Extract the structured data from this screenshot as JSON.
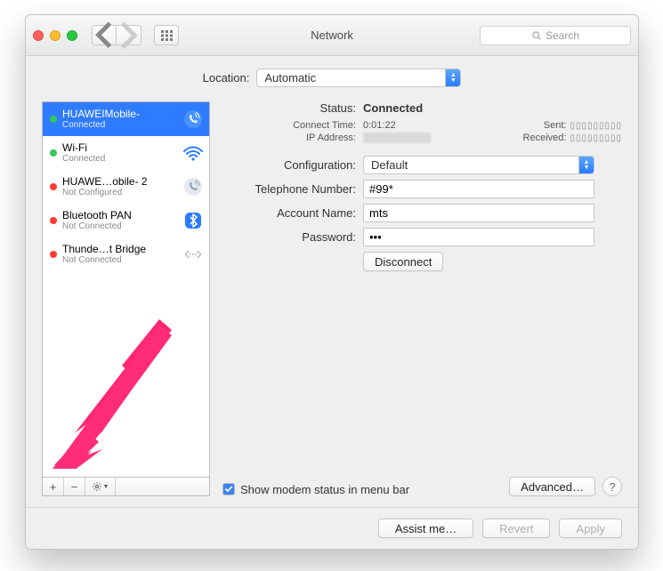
{
  "window": {
    "title": "Network"
  },
  "toolbar": {
    "search_placeholder": "Search"
  },
  "location": {
    "label": "Location:",
    "value": "Automatic"
  },
  "sidebar": {
    "items": [
      {
        "name": "HUAWEIMobile-",
        "status": "Connected",
        "status_color": "green",
        "icon": "phone",
        "selected": true
      },
      {
        "name": "Wi-Fi",
        "status": "Connected",
        "status_color": "green",
        "icon": "wifi",
        "selected": false
      },
      {
        "name": "HUAWE…obile- 2",
        "status": "Not Configured",
        "status_color": "red",
        "icon": "phone-gray",
        "selected": false
      },
      {
        "name": "Bluetooth PAN",
        "status": "Not Connected",
        "status_color": "red",
        "icon": "bluetooth",
        "selected": false
      },
      {
        "name": "Thunde…t Bridge",
        "status": "Not Connected",
        "status_color": "red",
        "icon": "thunderbolt",
        "selected": false
      }
    ],
    "add": "+",
    "remove": "−"
  },
  "detail": {
    "status_label": "Status:",
    "status_value": "Connected",
    "connect_time_label": "Connect Time:",
    "connect_time_value": "0:01:22",
    "ip_label": "IP Address:",
    "sent_label": "Sent:",
    "sent_value": "▯▯▯▯▯▯▯▯▯",
    "received_label": "Received:",
    "received_value": "▯▯▯▯▯▯▯▯▯",
    "configuration_label": "Configuration:",
    "configuration_value": "Default",
    "telephone_label": "Telephone Number:",
    "telephone_value": "#99*",
    "account_label": "Account Name:",
    "account_value": "mts",
    "password_label": "Password:",
    "password_value": "•••",
    "disconnect": "Disconnect",
    "show_status_label": "Show modem status in menu bar",
    "show_status_checked": true,
    "advanced": "Advanced…",
    "help": "?"
  },
  "footer": {
    "assist": "Assist me…",
    "revert": "Revert",
    "apply": "Apply"
  }
}
